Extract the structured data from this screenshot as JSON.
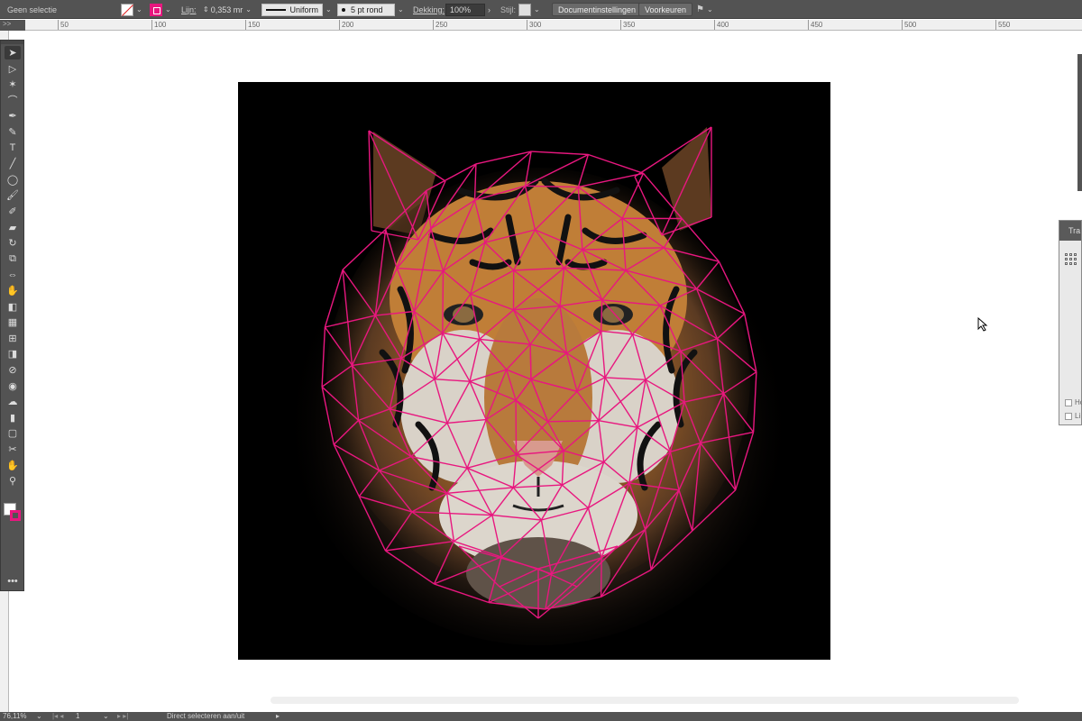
{
  "control_bar": {
    "selection_status": "Geen selectie",
    "stroke_label": "Lijn:",
    "stroke_weight": "0,353 mr",
    "profile": "Uniform",
    "brush": "5 pt rond",
    "opacity_label": "Dekking:",
    "opacity_value": "100%",
    "style_label": "Stijl:",
    "document_setup_button": "Documentinstellingen",
    "preferences_button": "Voorkeuren",
    "fill_color": "none",
    "stroke_color": "#e8177f"
  },
  "ruler": {
    "corner": ">>",
    "ticks": [
      "50",
      "100",
      "150",
      "200",
      "250",
      "300",
      "350",
      "400",
      "450",
      "500",
      "550"
    ]
  },
  "tools": [
    "selection-tool",
    "direct-selection-tool",
    "magic-wand-tool",
    "lasso-tool",
    "pen-tool",
    "curvature-tool",
    "type-tool",
    "line-tool",
    "ellipse-tool",
    "paintbrush-tool",
    "shaper-tool",
    "eraser-tool",
    "rotate-tool",
    "scale-tool",
    "width-tool",
    "puppet-warp-tool",
    "shape-builder-tool",
    "perspective-grid-tool",
    "mesh-tool",
    "gradient-tool",
    "eyedropper-tool",
    "blend-tool",
    "symbol-sprayer-tool",
    "column-graph-tool",
    "artboard-tool",
    "slice-tool",
    "hand-tool",
    "zoom-tool"
  ],
  "right_panel": {
    "title": "Tra",
    "options": [
      "Ho",
      "Li"
    ]
  },
  "status_bar": {
    "zoom": "76,11%",
    "artboard_number": "1",
    "status_text": "Direct selecteren aan/uit"
  },
  "mesh_color": "#e8177f"
}
